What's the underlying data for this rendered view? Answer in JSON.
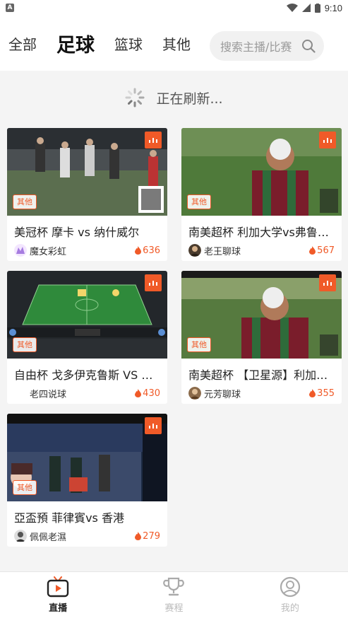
{
  "status_bar": {
    "time": "9:10",
    "notification_icon": "A"
  },
  "header": {
    "tabs": [
      {
        "label": "全部"
      },
      {
        "label": "足球"
      },
      {
        "label": "篮球"
      },
      {
        "label": "其他"
      }
    ],
    "active_tab": "足球",
    "search": {
      "placeholder": "搜索主播/比赛"
    }
  },
  "refresh": {
    "text": "正在刷新..."
  },
  "cards": [
    {
      "title": "美冠杯 摩卡 vs 纳什威尔",
      "tag": "其他",
      "streamer": "魔女彩虹",
      "heat": "636"
    },
    {
      "title": "南美超杯 利加大学vs弗鲁米…",
      "tag": "其他",
      "streamer": "老王聊球",
      "heat": "567"
    },
    {
      "title": "自由杯 戈多伊克鲁斯 VS 科…",
      "tag": "其他",
      "streamer": "老四说球",
      "heat": "430"
    },
    {
      "title": "南美超杯 【卫星源】利加大…",
      "tag": "其他",
      "streamer": "元芳聊球",
      "heat": "355"
    },
    {
      "title": "亞盃預 菲律賓vs 香港",
      "tag": "其他",
      "streamer": "佩佩老濕",
      "heat": "279"
    }
  ],
  "bottom_nav": [
    {
      "label": "直播",
      "icon": "tv-icon"
    },
    {
      "label": "赛程",
      "icon": "trophy-icon"
    },
    {
      "label": "我的",
      "icon": "user-icon"
    }
  ],
  "colors": {
    "accent": "#f05a28",
    "active_text": "#222222",
    "inactive_text": "#bbbbbb"
  }
}
